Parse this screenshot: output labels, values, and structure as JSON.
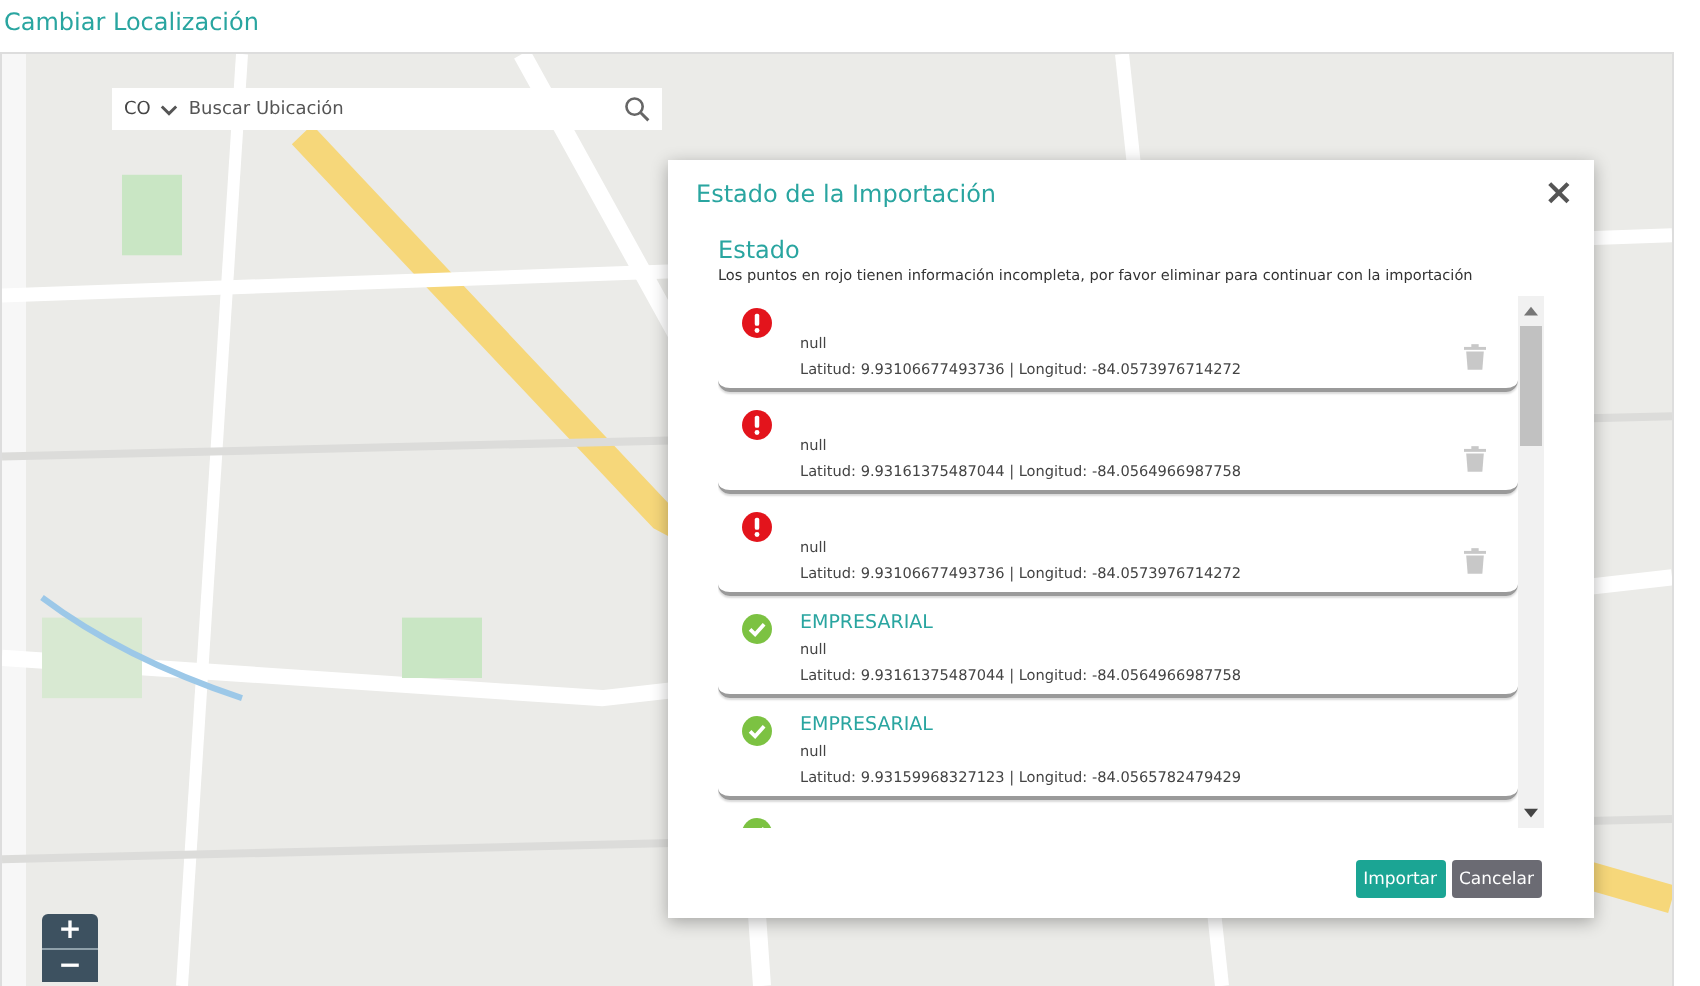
{
  "page": {
    "title": "Cambiar Localización"
  },
  "map": {
    "kind": "picture",
    "country": "CO",
    "search_placeholder": "Buscar Ubicación",
    "zoom_in": "+",
    "zoom_out": "−"
  },
  "dialog": {
    "title": "Estado de la Importación",
    "close": "×",
    "section_title": "Estado",
    "description": "Los puntos en rojo tienen información incompleta, por favor eliminar para continuar con la importación",
    "items": [
      {
        "kind": "error",
        "name": "null",
        "coords": "Latitud: 9.93106677493736 | Longitud: -84.0573976714272"
      },
      {
        "kind": "error",
        "name": "null",
        "coords": "Latitud: 9.93161375487044 | Longitud: -84.0564966987758"
      },
      {
        "kind": "error",
        "name": "null",
        "coords": "Latitud: 9.93106677493736 | Longitud: -84.0573976714272"
      },
      {
        "kind": "ok",
        "category": "EMPRESARIAL",
        "name": "null",
        "coords": "Latitud: 9.93161375487044 | Longitud: -84.0564966987758"
      },
      {
        "kind": "ok",
        "category": "EMPRESARIAL",
        "name": "null",
        "coords": "Latitud: 9.93159968327123 | Longitud: -84.0565782479429"
      },
      {
        "kind": "ok"
      }
    ],
    "buttons": [
      {
        "kind": "primary",
        "label": "Importar"
      },
      {
        "kind": "secondary",
        "label": "Cancelar"
      }
    ]
  }
}
